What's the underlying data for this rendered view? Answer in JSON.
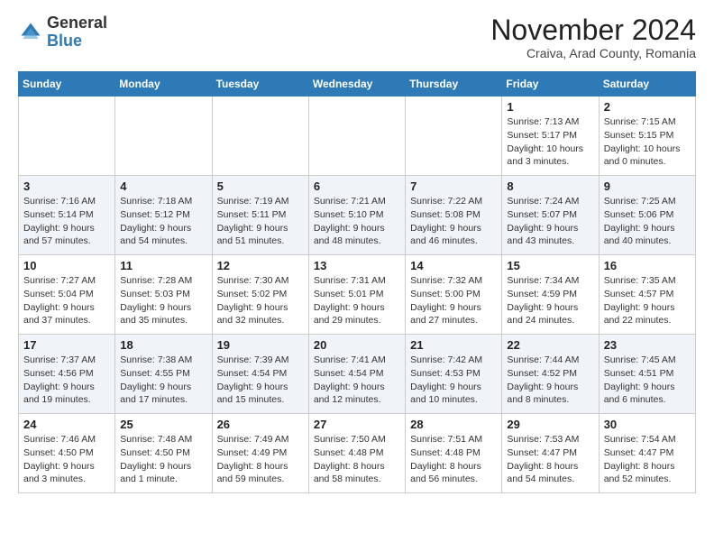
{
  "header": {
    "logo_general": "General",
    "logo_blue": "Blue",
    "title": "November 2024",
    "location": "Craiva, Arad County, Romania"
  },
  "days_of_week": [
    "Sunday",
    "Monday",
    "Tuesday",
    "Wednesday",
    "Thursday",
    "Friday",
    "Saturday"
  ],
  "weeks": [
    [
      {
        "day": "",
        "info": ""
      },
      {
        "day": "",
        "info": ""
      },
      {
        "day": "",
        "info": ""
      },
      {
        "day": "",
        "info": ""
      },
      {
        "day": "",
        "info": ""
      },
      {
        "day": "1",
        "info": "Sunrise: 7:13 AM\nSunset: 5:17 PM\nDaylight: 10 hours\nand 3 minutes."
      },
      {
        "day": "2",
        "info": "Sunrise: 7:15 AM\nSunset: 5:15 PM\nDaylight: 10 hours\nand 0 minutes."
      }
    ],
    [
      {
        "day": "3",
        "info": "Sunrise: 7:16 AM\nSunset: 5:14 PM\nDaylight: 9 hours\nand 57 minutes."
      },
      {
        "day": "4",
        "info": "Sunrise: 7:18 AM\nSunset: 5:12 PM\nDaylight: 9 hours\nand 54 minutes."
      },
      {
        "day": "5",
        "info": "Sunrise: 7:19 AM\nSunset: 5:11 PM\nDaylight: 9 hours\nand 51 minutes."
      },
      {
        "day": "6",
        "info": "Sunrise: 7:21 AM\nSunset: 5:10 PM\nDaylight: 9 hours\nand 48 minutes."
      },
      {
        "day": "7",
        "info": "Sunrise: 7:22 AM\nSunset: 5:08 PM\nDaylight: 9 hours\nand 46 minutes."
      },
      {
        "day": "8",
        "info": "Sunrise: 7:24 AM\nSunset: 5:07 PM\nDaylight: 9 hours\nand 43 minutes."
      },
      {
        "day": "9",
        "info": "Sunrise: 7:25 AM\nSunset: 5:06 PM\nDaylight: 9 hours\nand 40 minutes."
      }
    ],
    [
      {
        "day": "10",
        "info": "Sunrise: 7:27 AM\nSunset: 5:04 PM\nDaylight: 9 hours\nand 37 minutes."
      },
      {
        "day": "11",
        "info": "Sunrise: 7:28 AM\nSunset: 5:03 PM\nDaylight: 9 hours\nand 35 minutes."
      },
      {
        "day": "12",
        "info": "Sunrise: 7:30 AM\nSunset: 5:02 PM\nDaylight: 9 hours\nand 32 minutes."
      },
      {
        "day": "13",
        "info": "Sunrise: 7:31 AM\nSunset: 5:01 PM\nDaylight: 9 hours\nand 29 minutes."
      },
      {
        "day": "14",
        "info": "Sunrise: 7:32 AM\nSunset: 5:00 PM\nDaylight: 9 hours\nand 27 minutes."
      },
      {
        "day": "15",
        "info": "Sunrise: 7:34 AM\nSunset: 4:59 PM\nDaylight: 9 hours\nand 24 minutes."
      },
      {
        "day": "16",
        "info": "Sunrise: 7:35 AM\nSunset: 4:57 PM\nDaylight: 9 hours\nand 22 minutes."
      }
    ],
    [
      {
        "day": "17",
        "info": "Sunrise: 7:37 AM\nSunset: 4:56 PM\nDaylight: 9 hours\nand 19 minutes."
      },
      {
        "day": "18",
        "info": "Sunrise: 7:38 AM\nSunset: 4:55 PM\nDaylight: 9 hours\nand 17 minutes."
      },
      {
        "day": "19",
        "info": "Sunrise: 7:39 AM\nSunset: 4:54 PM\nDaylight: 9 hours\nand 15 minutes."
      },
      {
        "day": "20",
        "info": "Sunrise: 7:41 AM\nSunset: 4:54 PM\nDaylight: 9 hours\nand 12 minutes."
      },
      {
        "day": "21",
        "info": "Sunrise: 7:42 AM\nSunset: 4:53 PM\nDaylight: 9 hours\nand 10 minutes."
      },
      {
        "day": "22",
        "info": "Sunrise: 7:44 AM\nSunset: 4:52 PM\nDaylight: 9 hours\nand 8 minutes."
      },
      {
        "day": "23",
        "info": "Sunrise: 7:45 AM\nSunset: 4:51 PM\nDaylight: 9 hours\nand 6 minutes."
      }
    ],
    [
      {
        "day": "24",
        "info": "Sunrise: 7:46 AM\nSunset: 4:50 PM\nDaylight: 9 hours\nand 3 minutes."
      },
      {
        "day": "25",
        "info": "Sunrise: 7:48 AM\nSunset: 4:50 PM\nDaylight: 9 hours\nand 1 minute."
      },
      {
        "day": "26",
        "info": "Sunrise: 7:49 AM\nSunset: 4:49 PM\nDaylight: 8 hours\nand 59 minutes."
      },
      {
        "day": "27",
        "info": "Sunrise: 7:50 AM\nSunset: 4:48 PM\nDaylight: 8 hours\nand 58 minutes."
      },
      {
        "day": "28",
        "info": "Sunrise: 7:51 AM\nSunset: 4:48 PM\nDaylight: 8 hours\nand 56 minutes."
      },
      {
        "day": "29",
        "info": "Sunrise: 7:53 AM\nSunset: 4:47 PM\nDaylight: 8 hours\nand 54 minutes."
      },
      {
        "day": "30",
        "info": "Sunrise: 7:54 AM\nSunset: 4:47 PM\nDaylight: 8 hours\nand 52 minutes."
      }
    ]
  ]
}
